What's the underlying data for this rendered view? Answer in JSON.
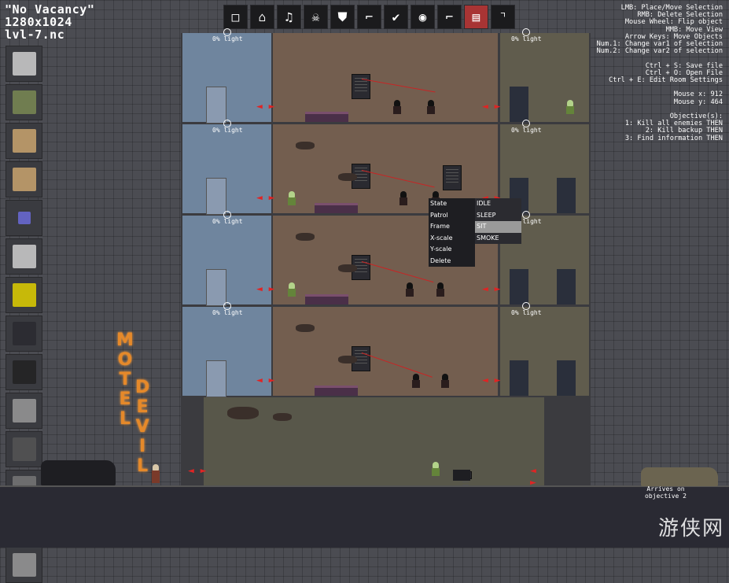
{
  "info": {
    "title": "\"No Vacancy\"",
    "resolution": "1280x1024",
    "filename": "lvl-7.nc"
  },
  "toolbar": {
    "tools": [
      {
        "name": "select-square-icon",
        "glyph": "□"
      },
      {
        "name": "house-icon",
        "glyph": "⌂"
      },
      {
        "name": "music-icon",
        "glyph": "♫"
      },
      {
        "name": "skull-icon",
        "glyph": "☠"
      },
      {
        "name": "shield-icon",
        "glyph": "⛊"
      },
      {
        "name": "gun-icon",
        "glyph": "⌐"
      },
      {
        "name": "check-icon",
        "glyph": "✔"
      },
      {
        "name": "lightbulb-icon",
        "glyph": "◉"
      },
      {
        "name": "stairs-icon",
        "glyph": "⌐"
      },
      {
        "name": "clapper-icon",
        "glyph": "▤"
      },
      {
        "name": "dotted-corner-icon",
        "glyph": "⌝"
      }
    ],
    "active_index": 9
  },
  "help": {
    "lines": [
      "LMB: Place/Move Selection",
      "RMB: Delete Selection",
      "Mouse Wheel: Flip object",
      "MMB: Move View",
      "Arrow Keys: Move Objects",
      "Num.1: Change var1 of selection",
      "Num.2: Change var2 of selection",
      "",
      "Ctrl + S: Save file",
      "Ctrl + O: Open File",
      "Ctrl + E: Edit Room Settings",
      "",
      "Mouse x: 912",
      "Mouse y: 464",
      "",
      "Objective(s):",
      "1: Kill all enemies THEN",
      "2: Kill backup THEN",
      "3: Find information THEN"
    ]
  },
  "palette": {
    "items": [
      "door-icon",
      "trash-bin-icon",
      "hostage-icon",
      "enemy-pair-icon",
      "blue-block-icon",
      "fan-icon",
      "exit-sign-icon",
      "window-icon",
      "vent-icon",
      "checker-icon",
      "building-icon",
      "pillar-icon",
      "plant-icon",
      "lamp-icon"
    ]
  },
  "light_label": "0% light",
  "context_menu": {
    "left": [
      "State",
      "Patrol",
      "Frame",
      "X-scale",
      "Y-scale",
      "Delete"
    ],
    "right": [
      "IDLE",
      "SLEEP",
      "SIT",
      "SMOKE"
    ],
    "selected_right_index": 2
  },
  "sign": {
    "motel": [
      "M",
      "O",
      "T",
      "E",
      "L"
    ],
    "devil": [
      "D",
      "E",
      "V",
      "I",
      "L"
    ]
  },
  "arrives": {
    "line1": "Arrives on",
    "line2": "objective 2"
  },
  "watermark": "游侠网",
  "colors": {
    "door_arrow": "#e02424",
    "laser": "#c72525",
    "active_tool": "#a83434",
    "neon": "#e5892a"
  }
}
